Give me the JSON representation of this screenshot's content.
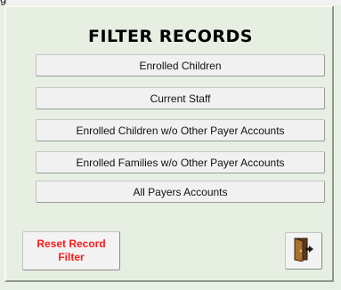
{
  "header_fragment": "g",
  "panel": {
    "title": "FILTER RECORDS",
    "buttons": [
      {
        "label": "Enrolled Children"
      },
      {
        "label": "Current Staff"
      },
      {
        "label": "Enrolled Children w/o Other Payer Accounts"
      },
      {
        "label": "Enrolled Families w/o Other Payer Accounts"
      },
      {
        "label": "All Payers Accounts"
      }
    ],
    "reset_label": "Reset Record\nFilter",
    "exit_icon": "exit-door-icon"
  },
  "colors": {
    "background": "#e8efe4",
    "reset_text": "#ff1a1a",
    "door": "#8b5a2b"
  }
}
